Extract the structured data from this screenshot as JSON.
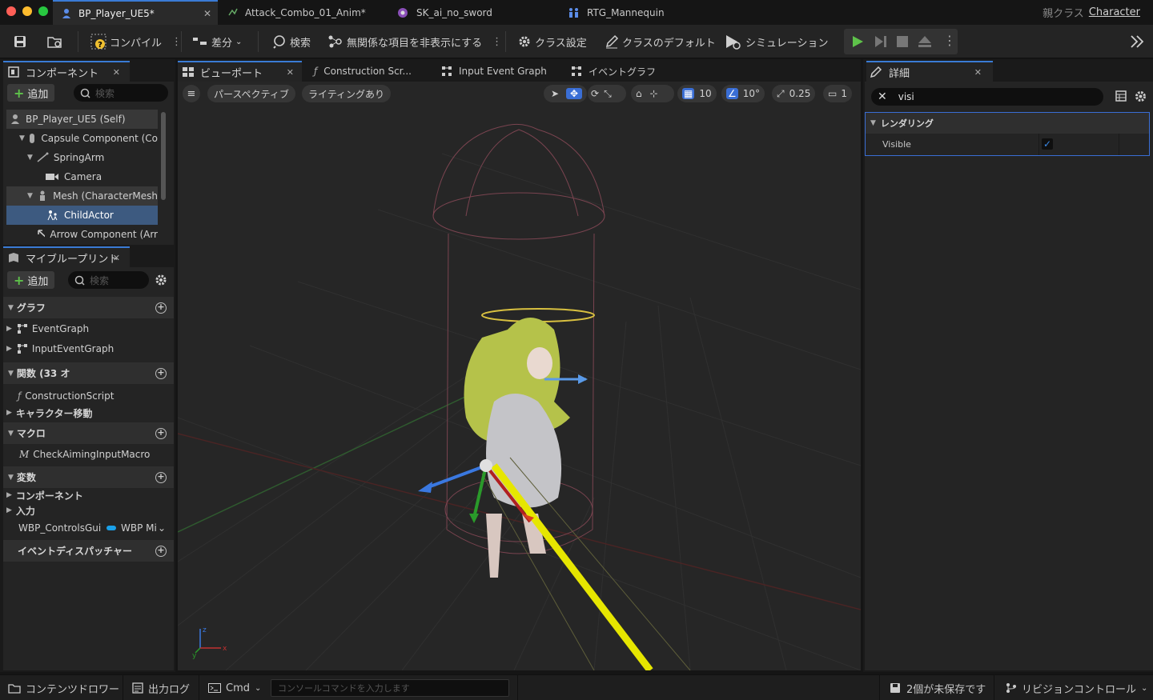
{
  "doc_tabs": [
    {
      "label": "BP_Player_UE5*",
      "active": true
    },
    {
      "label": "Attack_Combo_01_Anim*"
    },
    {
      "label": "SK_ai_no_sword"
    },
    {
      "label": "RTG_Mannequin"
    }
  ],
  "parent_class": {
    "label": "親クラス",
    "value": "Character"
  },
  "toolbar": {
    "compile": "コンパイル",
    "diff": "差分",
    "search": "検索",
    "hide_unrelated": "無関係な項目を非表示にする",
    "class_settings": "クラス設定",
    "class_defaults": "クラスのデフォルト",
    "simulation": "シミュレーション"
  },
  "components_panel": {
    "tab": "コンポーネント",
    "add": "追加",
    "search_placeholder": "検索",
    "items": [
      {
        "label": "BP_Player_UE5 (Self)"
      },
      {
        "label": "Capsule Component (Co"
      },
      {
        "label": "SpringArm"
      },
      {
        "label": "Camera"
      },
      {
        "label": "Mesh (CharacterMesh"
      },
      {
        "label": "ChildActor"
      },
      {
        "label": "Arrow Component (Arr"
      }
    ]
  },
  "my_blueprint": {
    "tab": "マイブループリント",
    "add": "追加",
    "search_placeholder": "検索",
    "sections": {
      "graph": "グラフ",
      "functions": "関数 (33 オ",
      "macro": "マクロ",
      "variables": "変数",
      "dispatchers": "イベントディスパッチャー"
    },
    "graph_items": [
      "EventGraph",
      "InputEventGraph"
    ],
    "function_items": [
      "ConstructionScript",
      "キャラクター移動"
    ],
    "macro_items": [
      "CheckAimingInputMacro"
    ],
    "variable_items": [
      "コンポーネント",
      "入力"
    ],
    "variable_row": {
      "name": "WBP_ControlsGui",
      "type": "WBP Mi"
    }
  },
  "editor_tabs": [
    {
      "label": "ビューポート",
      "active": true
    },
    {
      "label": "Construction Scr..."
    },
    {
      "label": "Input Event Graph"
    },
    {
      "label": "イベントグラフ"
    }
  ],
  "viewport": {
    "perspective": "パースペクティブ",
    "lighting": "ライティングあり",
    "grid_snap": "10",
    "rot_snap": "10°",
    "scale_snap": "0.25",
    "camera_speed": "1"
  },
  "details": {
    "tab": "詳細",
    "search_value": "visi",
    "section": "レンダリング",
    "property_name": "Visible",
    "property_checked": true
  },
  "statusbar": {
    "content_drawer": "コンテンツドロワー",
    "output_log": "出力ログ",
    "cmd": "Cmd",
    "console_placeholder": "コンソールコマンドを入力します",
    "unsaved": "2個が未保存です",
    "revision": "リビジョンコントロール"
  },
  "colors": {
    "accent_blue": "#3a7bd5",
    "play_green": "#5ec24a",
    "selection": "#3d5a80"
  }
}
